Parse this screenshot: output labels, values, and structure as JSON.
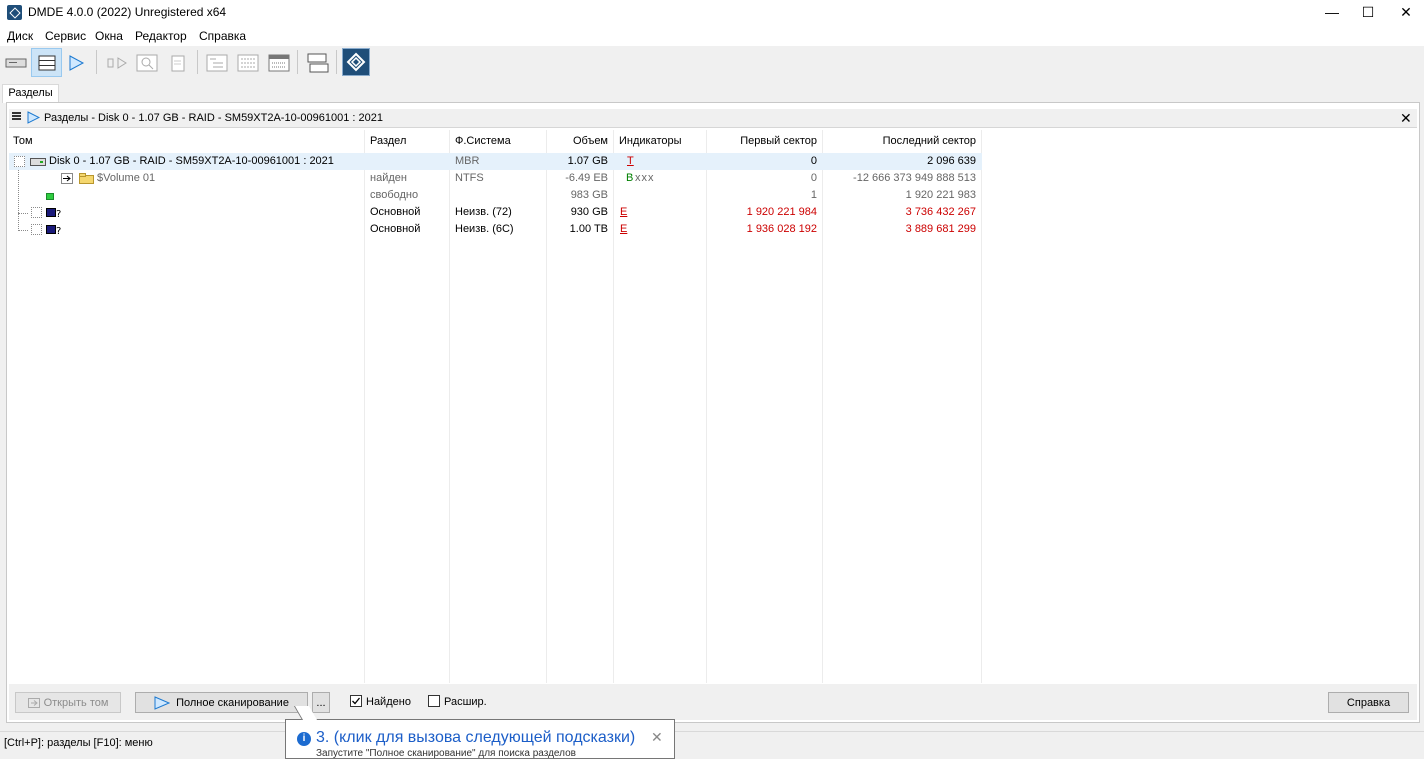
{
  "window": {
    "title": "DMDE 4.0.0 (2022) Unregistered x64"
  },
  "menu": [
    "Диск",
    "Сервис",
    "Окна",
    "Редактор",
    "Справка"
  ],
  "tabs": [
    "Разделы"
  ],
  "panel": {
    "title": "Разделы - Disk 0 - 1.07 GB - RAID - SM59XT2A-10-00961001 : 2021"
  },
  "columns": [
    "Том",
    "Раздел",
    "Ф.Система",
    "Объем",
    "Индикаторы",
    "Первый сектор",
    "Последний сектор"
  ],
  "rows": [
    {
      "tom": "Disk 0 - 1.07 GB - RAID - SM59XT2A-10-00961001 : 2021",
      "razdel": "",
      "fs": "MBR",
      "size": "1.07 GB",
      "ind": "T",
      "first": "0",
      "last": "2 096 639"
    },
    {
      "tom": "$Volume 01",
      "razdel": "найден",
      "fs": "NTFS",
      "size": "-6.49 EB",
      "ind_b": "B",
      "ind_x": "xxx",
      "first": "0",
      "last": "-12 666 373 949 888 513"
    },
    {
      "tom": "",
      "razdel": "свободно",
      "fs": "",
      "size": "983 GB",
      "ind": "",
      "first": "1",
      "last": "1 920 221 983"
    },
    {
      "tom": "",
      "razdel": "Основной",
      "fs": "Неизв. (72)",
      "size": "930 GB",
      "ind": "E",
      "first": "1 920 221 984",
      "last": "3 736 432 267"
    },
    {
      "tom": "",
      "razdel": "Основной",
      "fs": "Неизв. (6C)",
      "size": "1.00 TB",
      "ind": "E",
      "first": "1 936 028 192",
      "last": "3 889 681 299"
    }
  ],
  "buttons": {
    "open_volume": "Открыть том",
    "full_scan": "Полное сканирование",
    "more": "...",
    "found": "Найдено",
    "extended": "Расшир.",
    "help": "Справка"
  },
  "checks": {
    "found": true,
    "extended": false
  },
  "status": "[Ctrl+P]: разделы  [F10]: меню",
  "tooltip": {
    "text": "3. (клик для вызова следующей подсказки)",
    "sub": "Запустите \"Полное сканирование\" для поиска разделов"
  },
  "colors": {
    "accent": "#1f4e79",
    "error": "#cc0000",
    "ok": "#008000",
    "selection": "#e5f1fb"
  }
}
